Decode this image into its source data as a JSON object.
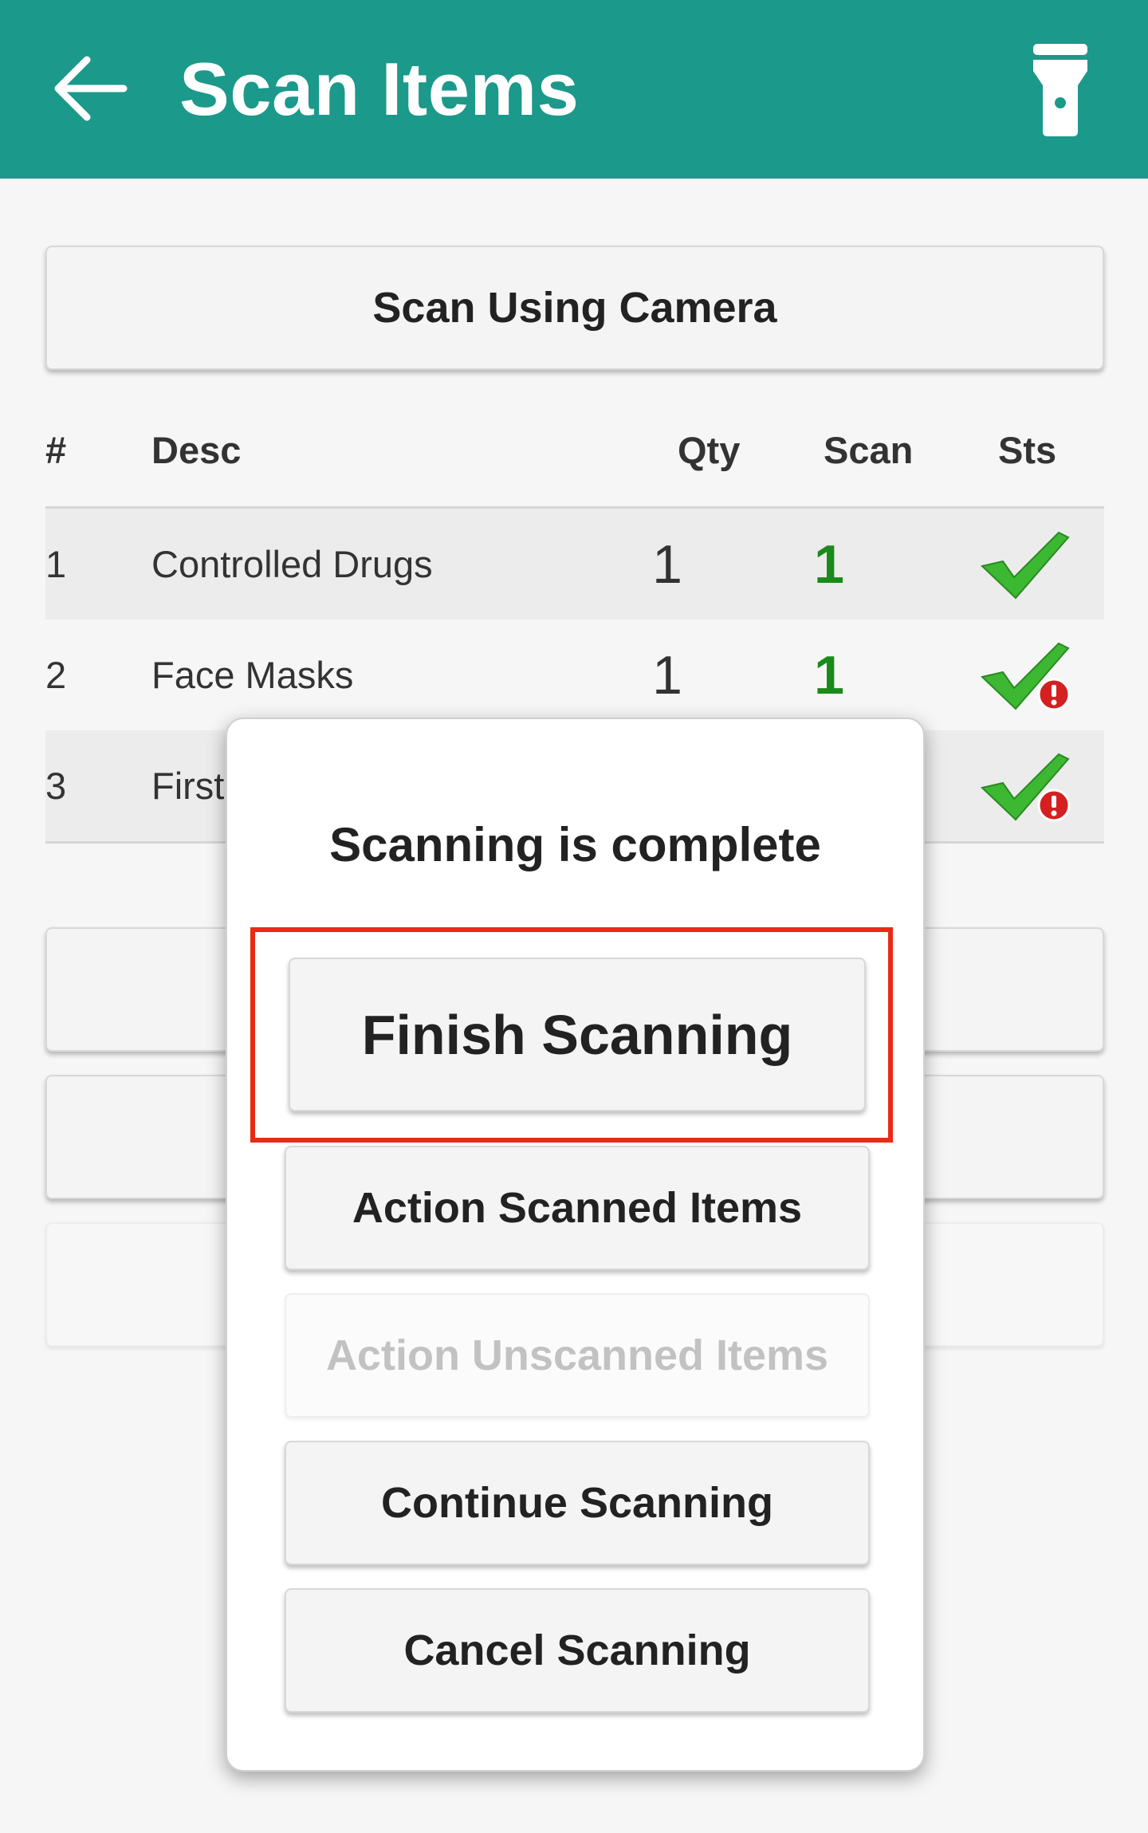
{
  "app_bar": {
    "title": "Scan Items",
    "back_icon": "arrow-left-icon",
    "torch_icon": "flashlight-icon",
    "color": "#1b998a"
  },
  "scan_camera_button": {
    "label": "Scan Using Camera"
  },
  "table": {
    "headers": {
      "num": "#",
      "desc": "Desc",
      "qty": "Qty",
      "scan": "Scan",
      "sts": "Sts"
    },
    "rows": [
      {
        "num": "1",
        "desc": "Controlled Drugs",
        "qty": "1",
        "scan": "1",
        "status": "ok"
      },
      {
        "num": "2",
        "desc": "Face Masks",
        "qty": "1",
        "scan": "1",
        "status": "warning"
      },
      {
        "num": "3",
        "desc": "First",
        "qty": "",
        "scan": "",
        "status": "warning"
      }
    ]
  },
  "dialog": {
    "title": "Scanning is complete",
    "finish_label": "Finish Scanning",
    "action_scanned_label": "Action Scanned Items",
    "action_unscanned_label": "Action Unscanned Items",
    "continue_label": "Continue Scanning",
    "cancel_label": "Cancel Scanning",
    "highlight_color": "#ea2a14"
  },
  "colors": {
    "scan_count": "#1a8a1a",
    "check": "#3cb832",
    "alert": "#d42020"
  }
}
